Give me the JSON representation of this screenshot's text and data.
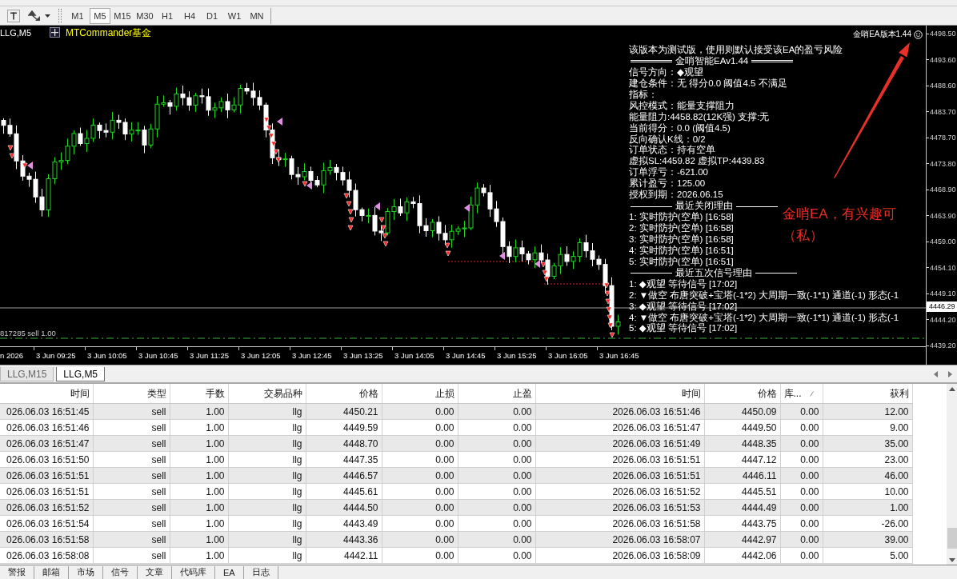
{
  "toolbar": {
    "timeframes": [
      {
        "label": "M1",
        "selected": false
      },
      {
        "label": "M5",
        "selected": true
      },
      {
        "label": "M15",
        "selected": false
      },
      {
        "label": "M30",
        "selected": false
      },
      {
        "label": "H1",
        "selected": false
      },
      {
        "label": "H4",
        "selected": false
      },
      {
        "label": "D1",
        "selected": false
      },
      {
        "label": "W1",
        "selected": false
      },
      {
        "label": "MN",
        "selected": false
      }
    ]
  },
  "chart": {
    "symbol_label": "LLG,M5",
    "indicator": "MTCommander基金",
    "version_label": "金哨EA版本1.44",
    "info_lines": [
      {
        "kind": "text",
        "text": "该版本为测试版，使用则默认接受该EA的盈亏风险"
      },
      {
        "kind": "double_rule_heading",
        "text": "金哨智能EAv1.44"
      },
      {
        "kind": "text",
        "text": "信号方向：◆观望"
      },
      {
        "kind": "text",
        "text": "建仓条件：无 得分0.0 阈值4.5 不满足"
      },
      {
        "kind": "text",
        "text": "指标："
      },
      {
        "kind": "text",
        "text": "风控模式：能量支撑阻力"
      },
      {
        "kind": "text",
        "text": "能量阻力:4458.82(12K强) 支撑:无"
      },
      {
        "kind": "text",
        "text": "当前得分：0.0 (阈值4.5)"
      },
      {
        "kind": "text",
        "text": "反向确认K线：0/2"
      },
      {
        "kind": "text",
        "text": "订单状态：持有空单"
      },
      {
        "kind": "text",
        "text": "虚拟SL:4459.82 虚拟TP:4439.83"
      },
      {
        "kind": "text",
        "text": "订单浮亏：-621.00"
      },
      {
        "kind": "text",
        "text": "累计盈亏：125.00"
      },
      {
        "kind": "text",
        "text": "授权到期：2026.06.15"
      },
      {
        "kind": "rule_heading",
        "text": "最近关闭理由"
      },
      {
        "kind": "text",
        "text": "1: 实时防护(空单) [16:58]"
      },
      {
        "kind": "text",
        "text": "2: 实时防护(空单) [16:58]"
      },
      {
        "kind": "text",
        "text": "3: 实时防护(空单) [16:58]"
      },
      {
        "kind": "text",
        "text": "4: 实时防护(空单) [16:51]"
      },
      {
        "kind": "text",
        "text": "5: 实时防护(空单) [16:51]"
      },
      {
        "kind": "rule_heading",
        "text": "最近五次信号理由"
      },
      {
        "kind": "text",
        "text": "1: ◆观望 等待信号 [17:02]"
      },
      {
        "kind": "text",
        "text": "2: ▼做空 布唐突破+宝塔(-1*2) 大周期一致(-1*1) 通道(-1) 形态(-1"
      },
      {
        "kind": "text",
        "text": "3: ◆观望 等待信号 [17:02]"
      },
      {
        "kind": "text",
        "text": "4: ▼做空 布唐突破+宝塔(-1*2) 大周期一致(-1*1) 通道(-1) 形态(-1"
      },
      {
        "kind": "text",
        "text": "5: ◆观望 等待信号 [17:02]"
      }
    ],
    "annotation": [
      "金哨EA，有兴趣可",
      "（私）"
    ],
    "order_label": "817285 sell 1.00",
    "price_axis": {
      "ticks": [
        "4498.50",
        "4493.60",
        "4488.60",
        "4483.70",
        "4478.70",
        "4473.80",
        "4468.90",
        "4463.90",
        "4459.00",
        "4454.10",
        "4449.10",
        "4444.20",
        "4439.20"
      ],
      "current": "4446.29"
    },
    "time_axis": [
      "n 2026",
      "3 Jun 09:25",
      "3 Jun 10:05",
      "3 Jun 10:45",
      "3 Jun 11:25",
      "3 Jun 12:05",
      "3 Jun 12:45",
      "3 Jun 13:25",
      "3 Jun 14:05",
      "3 Jun 14:45",
      "3 Jun 15:25",
      "3 Jun 16:05",
      "3 Jun 16:45"
    ]
  },
  "chart_tabs": [
    {
      "label": "LLG,M15",
      "selected": false
    },
    {
      "label": "LLG,M5",
      "selected": true
    }
  ],
  "table": {
    "columns": [
      {
        "label": "时间",
        "sorted": false
      },
      {
        "label": "类型",
        "sorted": false
      },
      {
        "label": "手数",
        "sorted": false
      },
      {
        "label": "交易品种",
        "sorted": false
      },
      {
        "label": "价格",
        "sorted": false
      },
      {
        "label": "止损",
        "sorted": false
      },
      {
        "label": "止盈",
        "sorted": false
      },
      {
        "label": "时间",
        "sorted": false
      },
      {
        "label": "价格",
        "sorted": false
      },
      {
        "label": "库...",
        "sorted": true
      },
      {
        "label": "获利",
        "sorted": false
      }
    ],
    "rows": [
      [
        "026.06.03 16:51:45",
        "sell",
        "1.00",
        "llg",
        "4450.21",
        "0.00",
        "0.00",
        "2026.06.03 16:51:46",
        "4450.09",
        "0.00",
        "12.00"
      ],
      [
        "026.06.03 16:51:46",
        "sell",
        "1.00",
        "llg",
        "4449.59",
        "0.00",
        "0.00",
        "2026.06.03 16:51:47",
        "4449.50",
        "0.00",
        "9.00"
      ],
      [
        "026.06.03 16:51:47",
        "sell",
        "1.00",
        "llg",
        "4448.70",
        "0.00",
        "0.00",
        "2026.06.03 16:51:49",
        "4448.35",
        "0.00",
        "35.00"
      ],
      [
        "026.06.03 16:51:50",
        "sell",
        "1.00",
        "llg",
        "4447.35",
        "0.00",
        "0.00",
        "2026.06.03 16:51:51",
        "4447.12",
        "0.00",
        "23.00"
      ],
      [
        "026.06.03 16:51:51",
        "sell",
        "1.00",
        "llg",
        "4446.57",
        "0.00",
        "0.00",
        "2026.06.03 16:51:51",
        "4446.11",
        "0.00",
        "46.00"
      ],
      [
        "026.06.03 16:51:51",
        "sell",
        "1.00",
        "llg",
        "4445.61",
        "0.00",
        "0.00",
        "2026.06.03 16:51:52",
        "4445.51",
        "0.00",
        "10.00"
      ],
      [
        "026.06.03 16:51:52",
        "sell",
        "1.00",
        "llg",
        "4444.50",
        "0.00",
        "0.00",
        "2026.06.03 16:51:53",
        "4444.49",
        "0.00",
        "1.00"
      ],
      [
        "026.06.03 16:51:54",
        "sell",
        "1.00",
        "llg",
        "4443.49",
        "0.00",
        "0.00",
        "2026.06.03 16:51:58",
        "4443.75",
        "0.00",
        "-26.00"
      ],
      [
        "026.06.03 16:51:58",
        "sell",
        "1.00",
        "llg",
        "4443.36",
        "0.00",
        "0.00",
        "2026.06.03 16:58:07",
        "4442.97",
        "0.00",
        "39.00"
      ],
      [
        "026.06.03 16:58:08",
        "sell",
        "1.00",
        "llg",
        "4442.11",
        "0.00",
        "0.00",
        "2026.06.03 16:58:09",
        "4442.06",
        "0.00",
        "5.00"
      ]
    ]
  },
  "bottom_tabs": [
    "警报",
    "邮箱",
    "市场",
    "信号",
    "文章",
    "代码库",
    "EA",
    "日志"
  ]
}
